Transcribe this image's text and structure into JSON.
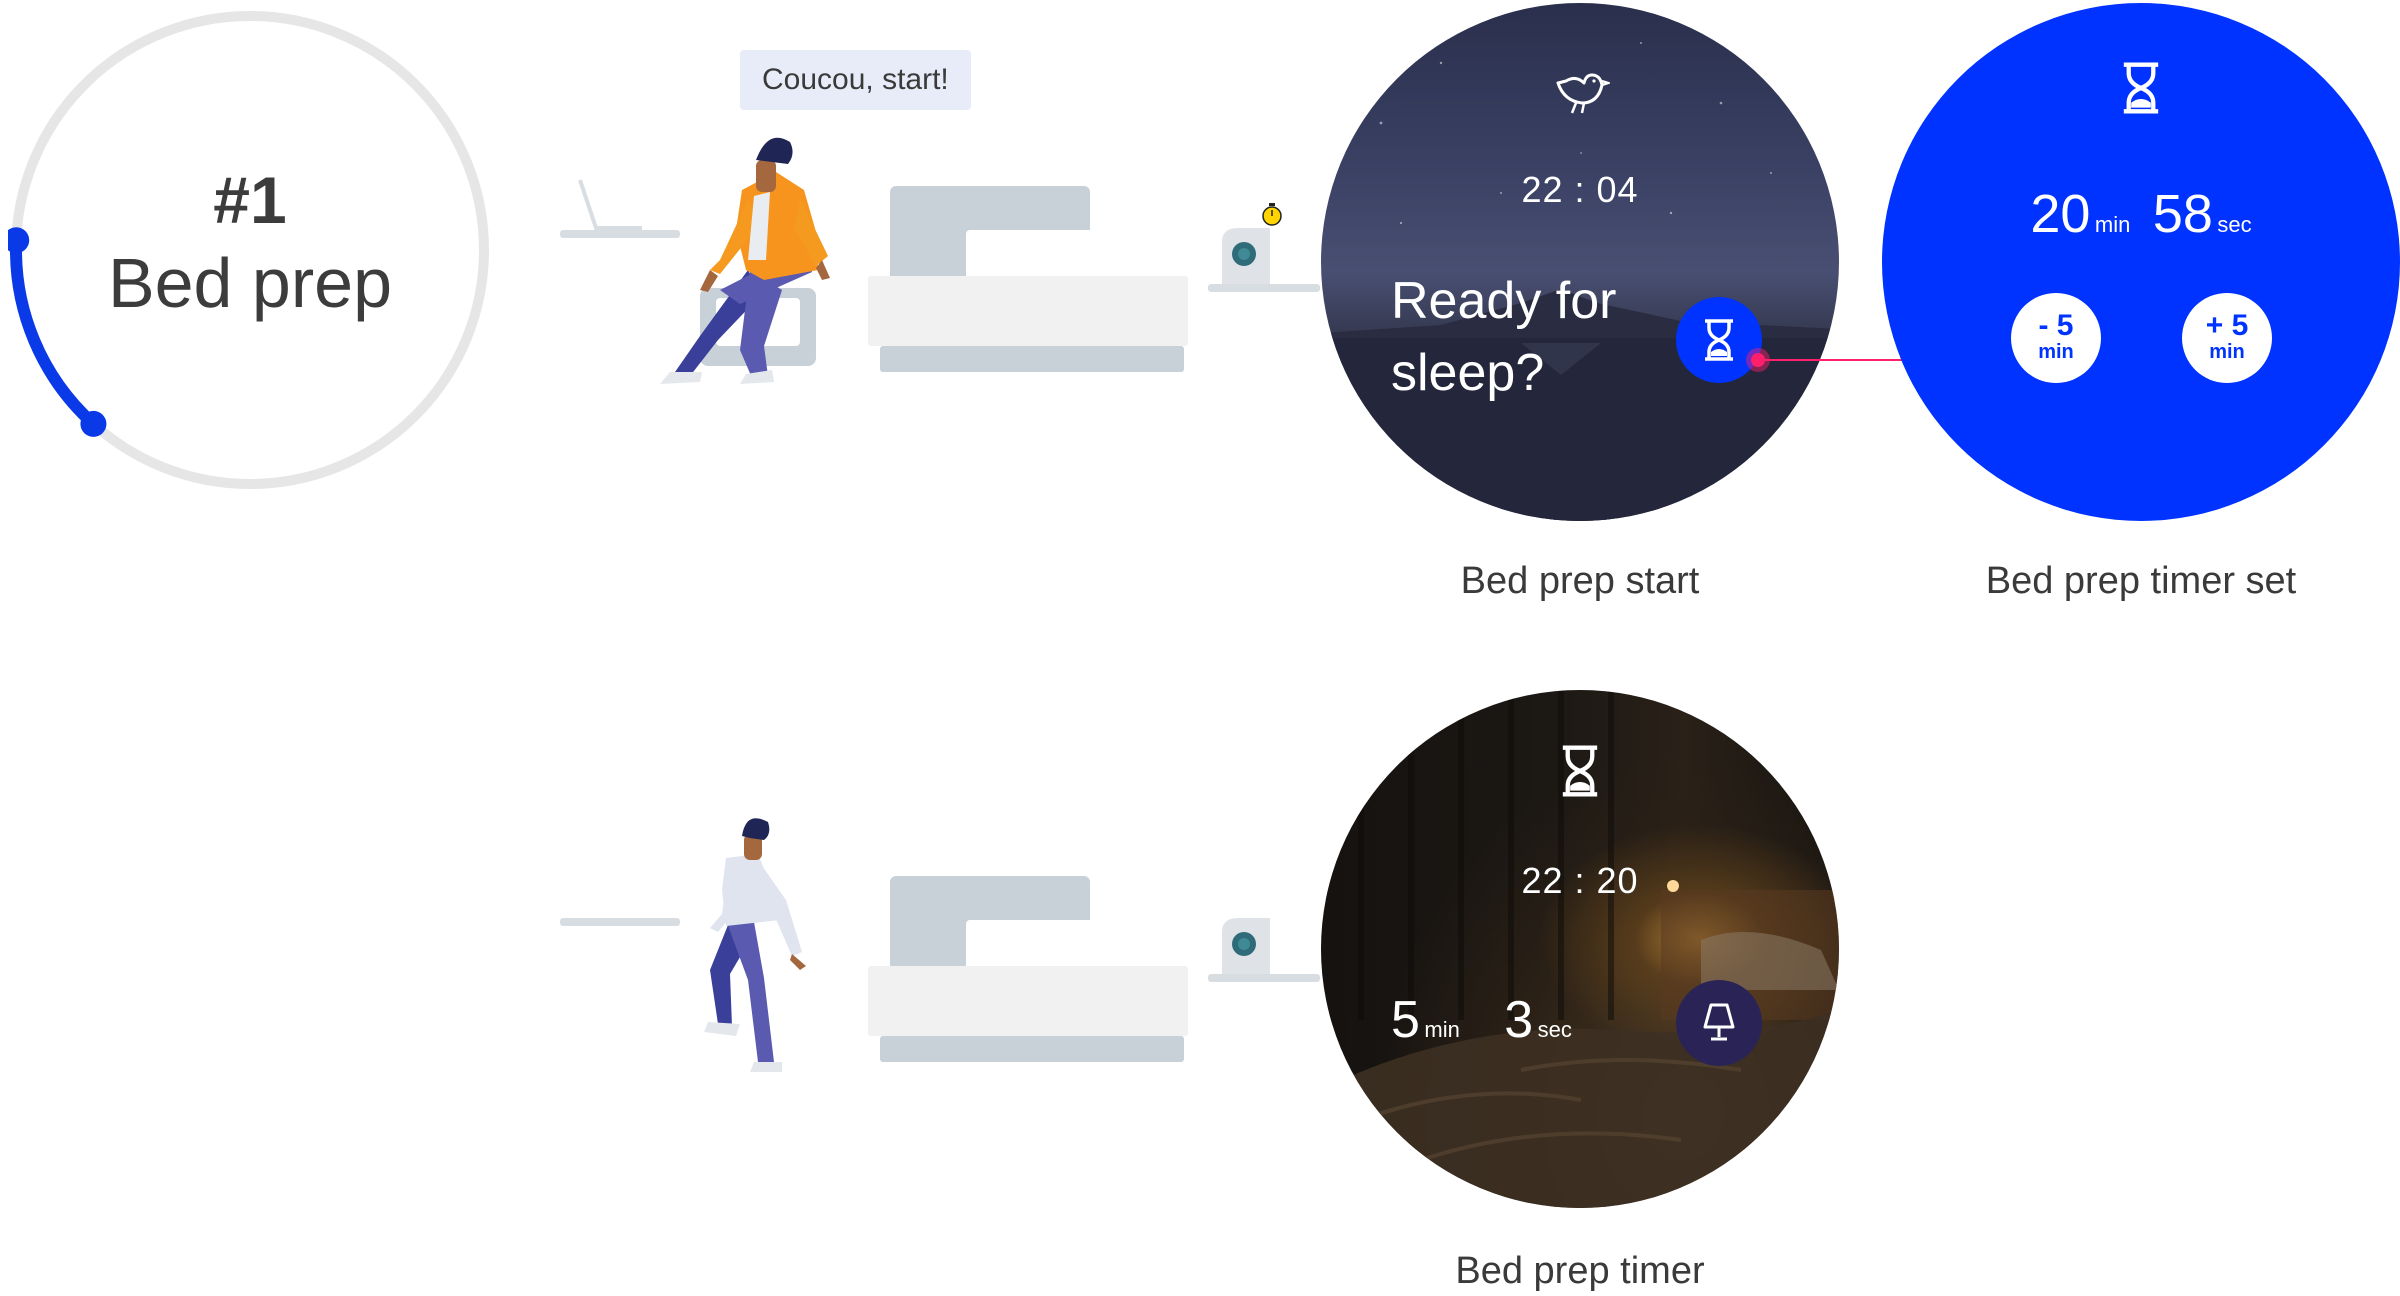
{
  "step": {
    "number": "#1",
    "title": "Bed prep",
    "progress": 0.14
  },
  "bubble": {
    "text": "Coucou, start!"
  },
  "screens": {
    "start": {
      "icon": "bird-icon",
      "time": "22 : 04",
      "headline_line1": "Ready for",
      "headline_line2": "sleep?",
      "button_icon": "hourglass-icon",
      "caption": "Bed prep start"
    },
    "timer_set": {
      "icon": "hourglass-icon",
      "minutes": "20",
      "minutes_unit": "min",
      "seconds": "58",
      "seconds_unit": "sec",
      "decrease_value": "- 5",
      "decrease_unit": "min",
      "increase_value": "+ 5",
      "increase_unit": "min",
      "caption": "Bed prep timer set"
    },
    "timer": {
      "icon": "hourglass-icon",
      "time": "22 : 20",
      "minutes": "5",
      "minutes_unit": "min",
      "seconds": "3",
      "seconds_unit": "sec",
      "button_icon": "lamp-icon",
      "caption": "Bed prep timer"
    }
  },
  "colors": {
    "accent_blue": "#0033ff",
    "progress_blue": "#0a3ae8",
    "ring_gray": "#e6e6e6",
    "pointer_pink": "#ff1f6b",
    "jacket_orange": "#f7941d",
    "pants_purple": "#5a5bb0",
    "furniture_gray": "#c8d0d8"
  }
}
